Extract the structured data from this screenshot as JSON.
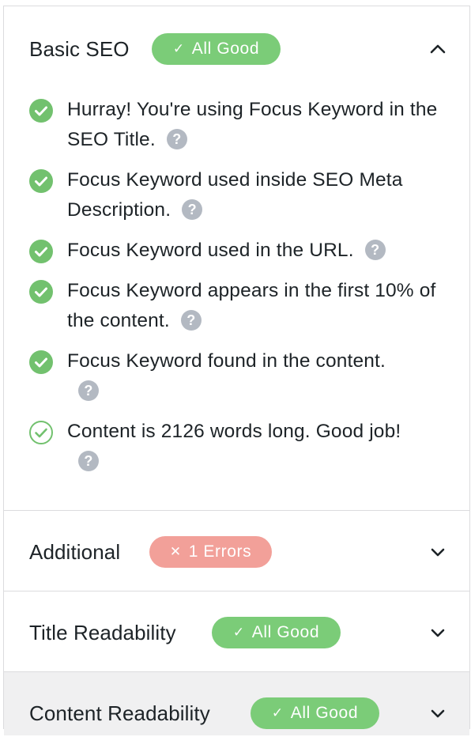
{
  "sections": {
    "basic": {
      "title": "Basic SEO",
      "badge": "All Good",
      "items": [
        {
          "text": "Hurray! You're using Focus Keyword in the SEO Title.",
          "icon": "check-circle-filled"
        },
        {
          "text": "Focus Keyword used inside SEO Meta Description.",
          "icon": "check-circle-filled"
        },
        {
          "text": "Focus Keyword used in the URL.",
          "icon": "check-circle-filled"
        },
        {
          "text": "Focus Keyword appears in the first 10% of the content.",
          "icon": "check-circle-filled"
        },
        {
          "text": "Focus Keyword found in the content.",
          "icon": "check-circle-filled"
        },
        {
          "text": "Content is 2126 words long. Good job!",
          "icon": "check-circle-outline"
        }
      ],
      "help_label": "?"
    },
    "additional": {
      "title": "Additional",
      "badge": "1 Errors"
    },
    "title_readability": {
      "title": "Title Readability",
      "badge": "All Good"
    },
    "content_readability": {
      "title": "Content Readability",
      "badge": "All Good"
    }
  },
  "colors": {
    "good": "#7bcc78",
    "bad": "#f2a099",
    "check": "#72c16e",
    "help": "#b3b9c2",
    "highlight_bg": "#f0f0f1"
  }
}
